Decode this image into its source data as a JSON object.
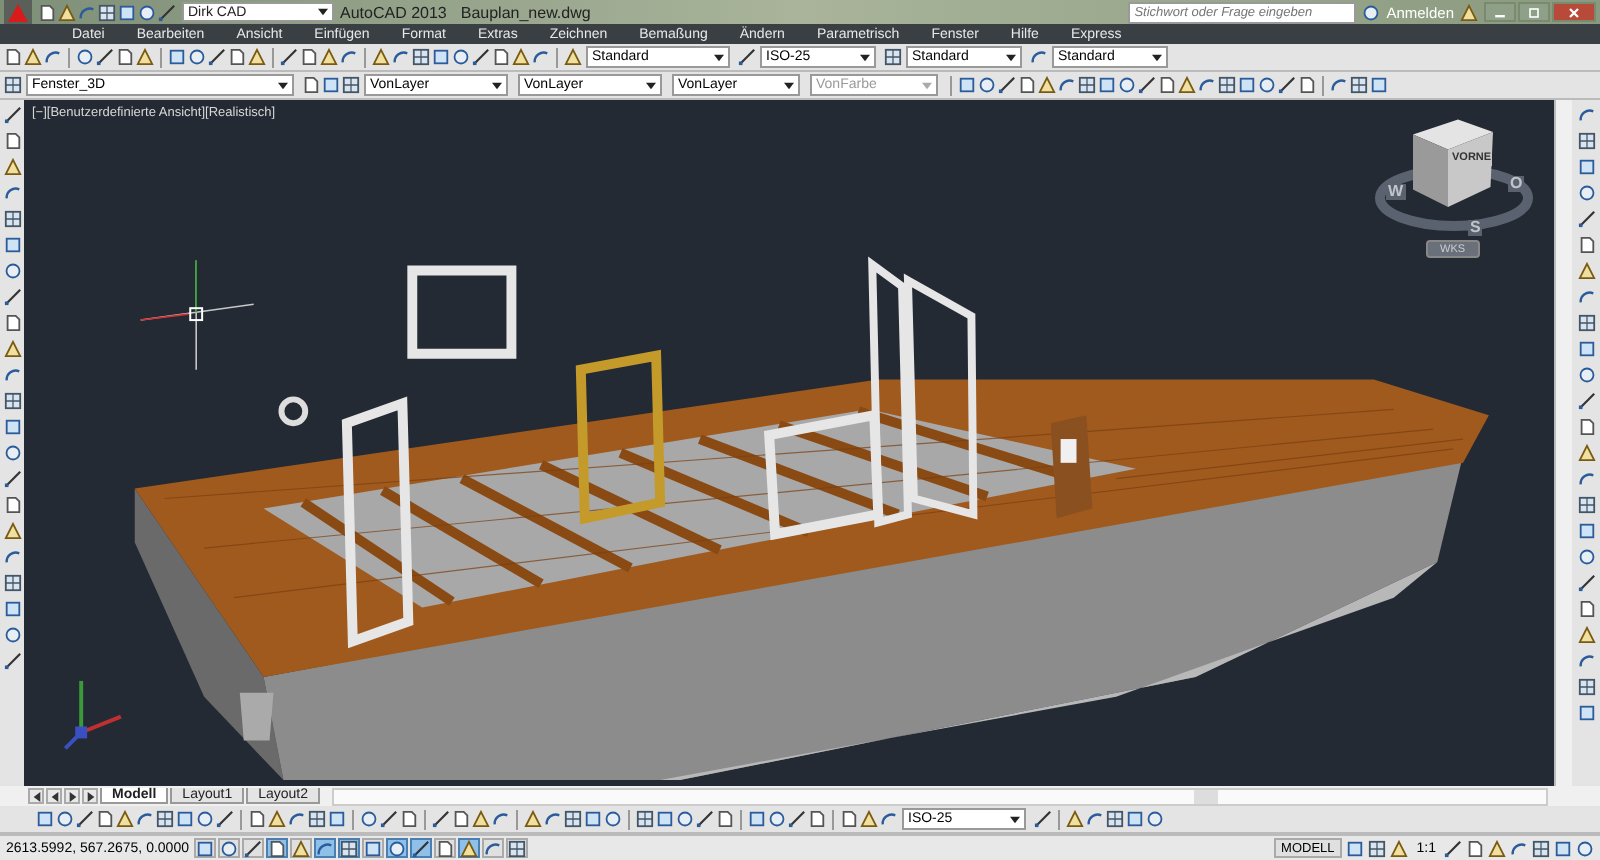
{
  "title_bar": {
    "workspace": "Dirk CAD",
    "app_title": "AutoCAD 2013",
    "file_name": "Bauplan_new.dwg",
    "search": {
      "placeholder": "Stichwort oder Frage eingeben"
    },
    "sign_in": "Anmelden"
  },
  "menu": [
    "Datei",
    "Bearbeiten",
    "Ansicht",
    "Einfügen",
    "Format",
    "Extras",
    "Zeichnen",
    "Bemaßung",
    "Ändern",
    "Parametrisch",
    "Fenster",
    "Hilfe",
    "Express"
  ],
  "style_toolbar": {
    "text_style": "Standard",
    "dim_style": "ISO-25",
    "table_style": "Standard",
    "multileader_style": "Standard"
  },
  "layer_toolbar": {
    "layer": "Fenster_3D",
    "color_setting": "VonLayer",
    "linetype": "VonLayer",
    "lineweight": "VonLayer",
    "plot_style": {
      "value": "VonFarbe",
      "disabled": true
    }
  },
  "viewport": {
    "label": "[−][Benutzerdefinierte Ansicht][Realistisch]",
    "viewcube": {
      "face": "VORNE",
      "compass": [
        "W",
        "S",
        "O"
      ],
      "ucs_menu": "WKS"
    }
  },
  "layout_tabs": [
    {
      "label": "Modell",
      "selected": true
    },
    {
      "label": "Layout1",
      "selected": false
    },
    {
      "label": "Layout2",
      "selected": false
    }
  ],
  "dim_toolbar": {
    "dim_style": "ISO-25"
  },
  "status_bar": {
    "coordinates": "2613.5992, 567.2675, 0.0000",
    "toggles": [
      {
        "on": false
      },
      {
        "on": false
      },
      {
        "on": false
      },
      {
        "on": true
      },
      {
        "on": false
      },
      {
        "on": true
      },
      {
        "on": true
      },
      {
        "on": false
      },
      {
        "on": true
      },
      {
        "on": true
      },
      {
        "on": false
      },
      {
        "on": true
      },
      {
        "on": false
      },
      {
        "on": false
      }
    ],
    "space": "MODELL",
    "scale": "1:1"
  }
}
